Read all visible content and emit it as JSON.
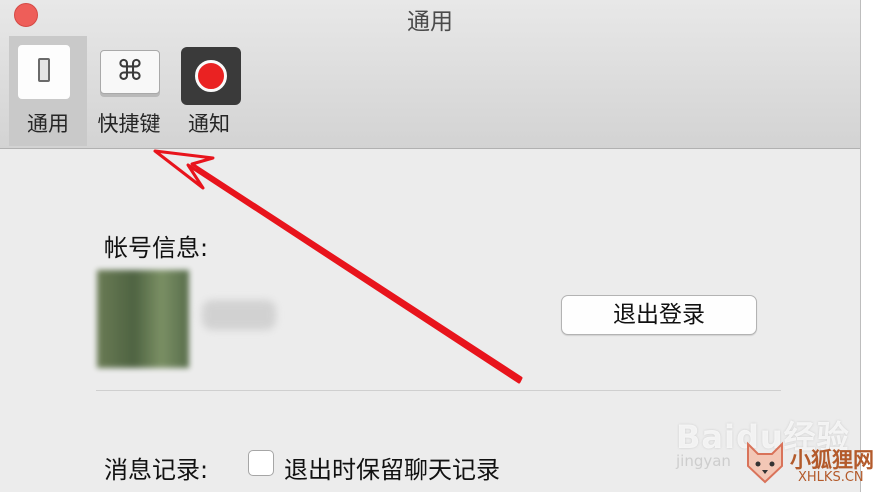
{
  "window": {
    "title": "通用"
  },
  "toolbar": {
    "tabs": [
      {
        "label": "通用",
        "icon": "toggle-switch-icon",
        "selected": true
      },
      {
        "label": "快捷键",
        "icon": "command-key-icon",
        "glyph": "⌘",
        "selected": false
      },
      {
        "label": "通知",
        "icon": "record-dot-icon",
        "selected": false
      }
    ]
  },
  "account": {
    "label": "帐号信息:",
    "logout_button": "退出登录"
  },
  "history": {
    "label": "消息记录:",
    "keep_checkbox_label": "退出时保留聊天记录",
    "keep_checked": false
  },
  "annotation": {
    "arrow_color": "#e8141c"
  },
  "watermark": {
    "logo": "Baidu经验",
    "subtext": "jingyan",
    "brand": "小狐狸网",
    "domain": "XHLKS.CN"
  },
  "colors": {
    "close_button": "#ee5e59",
    "background": "#ececec"
  }
}
